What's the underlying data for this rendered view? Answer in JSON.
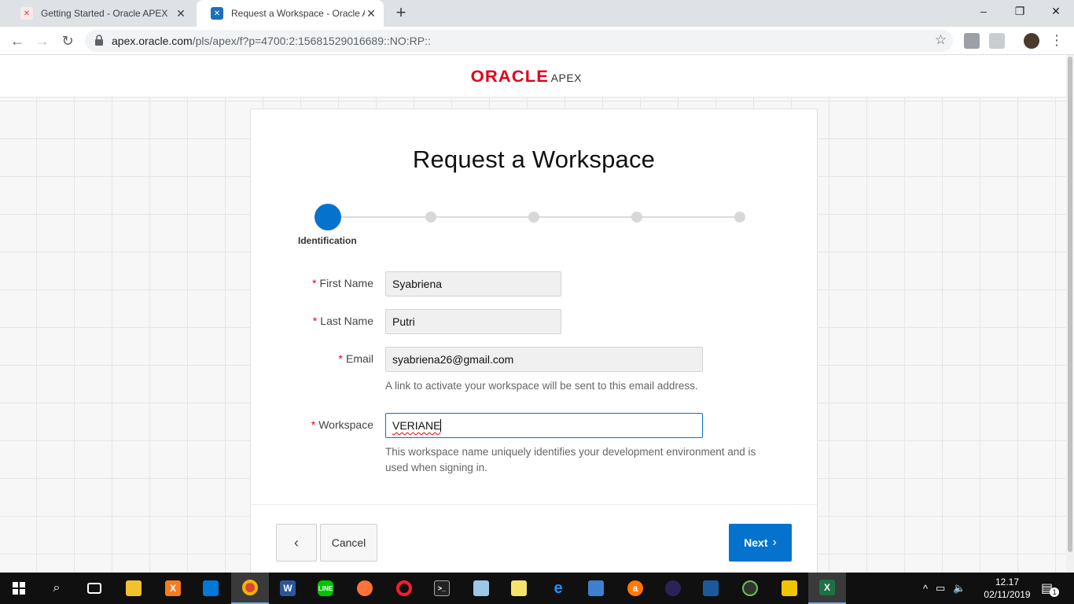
{
  "browser": {
    "tabs": [
      {
        "title": "Getting Started - Oracle APEX",
        "active": false
      },
      {
        "title": "Request a Workspace - Oracle Ap",
        "active": true
      }
    ],
    "url_host": "apex.oracle.com",
    "url_path": "/pls/apex/f?p=4700:2:15681529016689::NO:RP::"
  },
  "header": {
    "logo_oracle": "ORACLE",
    "logo_apex": "APEX"
  },
  "form": {
    "title": "Request a Workspace",
    "steps": [
      {
        "label": "Identification",
        "active": true
      },
      {
        "label": "",
        "active": false
      },
      {
        "label": "",
        "active": false
      },
      {
        "label": "",
        "active": false
      },
      {
        "label": "",
        "active": false
      }
    ],
    "required_mark": "*",
    "first_name": {
      "label": "First Name",
      "value": "Syabriena"
    },
    "last_name": {
      "label": "Last Name",
      "value": "Putri"
    },
    "email": {
      "label": "Email",
      "value": "syabriena26@gmail.com",
      "help": "A link to activate your workspace will be sent to this email address."
    },
    "workspace": {
      "label": "Workspace",
      "value": "VERIANE",
      "help_line1": "This workspace name uniquely identifies your development environment and is",
      "help_line2": "used when signing in."
    },
    "buttons": {
      "back": "‹",
      "cancel": "Cancel",
      "next": "Next",
      "next_chevron": "›"
    }
  },
  "taskbar": {
    "time": "12.17",
    "date": "02/11/2019",
    "notification_count": "1"
  },
  "colors": {
    "accent": "#0572ce",
    "oracle_red": "#e3001b"
  }
}
